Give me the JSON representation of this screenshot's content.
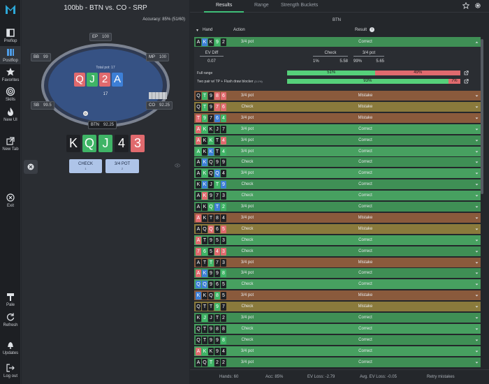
{
  "sidebar": {
    "items": [
      {
        "label": "Preflop",
        "icon": "preflop-icon"
      },
      {
        "label": "Postflop",
        "icon": "postflop-icon"
      },
      {
        "label": "Favorites",
        "icon": "star-icon"
      },
      {
        "label": "Skills",
        "icon": "target-icon"
      },
      {
        "label": "New UI",
        "icon": "flame-icon"
      },
      {
        "label": "New Tab",
        "icon": "new-tab-icon"
      },
      {
        "label": "Exit",
        "icon": "exit-icon"
      },
      {
        "label": "Pale",
        "icon": "paint-icon"
      },
      {
        "label": "Refresh",
        "icon": "refresh-icon"
      },
      {
        "label": "Updates",
        "icon": "bell-icon"
      },
      {
        "label": "Log out",
        "icon": "logout-icon"
      }
    ]
  },
  "trainer": {
    "title": "100bb - BTN vs. CO - SRP",
    "accuracy": "Accuracy:  85% (51/60)",
    "seats": {
      "ep": {
        "name": "EP",
        "stack": "100"
      },
      "mp": {
        "name": "MP",
        "stack": "100"
      },
      "bb": {
        "name": "BB",
        "stack": "99"
      },
      "sb": {
        "name": "SB",
        "stack": "99.5"
      },
      "co": {
        "name": "CO",
        "stack": "92.25"
      },
      "btn": {
        "name": "BTN",
        "stack": "92.25"
      }
    },
    "total_pot_label": "Total pot: 17",
    "pot": "17",
    "board": [
      {
        "rank": "Q",
        "suit": "hearts"
      },
      {
        "rank": "J",
        "suit": "clubs"
      },
      {
        "rank": "2",
        "suit": "hearts"
      },
      {
        "rank": "A",
        "suit": "diamonds"
      }
    ],
    "hero_cards": [
      {
        "rank": "K",
        "suit": "spades"
      },
      {
        "rank": "Q",
        "suit": "clubs"
      },
      {
        "rank": "J",
        "suit": "clubs"
      },
      {
        "rank": "4",
        "suit": "spades"
      },
      {
        "rank": "3",
        "suit": "hearts"
      }
    ],
    "dealer": "D",
    "actions": [
      {
        "label": "CHECK",
        "key": "1"
      },
      {
        "label": "3/4 POT",
        "key": "2"
      }
    ]
  },
  "results": {
    "tabs": [
      "Results",
      "Range",
      "Strength Buckets"
    ],
    "active_tab": "Results",
    "position_label": "BTN",
    "headers": {
      "hand": "Hand",
      "action": "Action",
      "result": "Result"
    },
    "expanded": {
      "hand": [
        {
          "rank": "A",
          "suit": "spades"
        },
        {
          "rank": "K",
          "suit": "diamonds"
        },
        {
          "rank": "K",
          "suit": "spades"
        },
        {
          "rank": "9",
          "suit": "clubs"
        },
        {
          "rank": "2",
          "suit": "spades"
        }
      ],
      "action": "3/4 pot",
      "result": "Correct",
      "ev_diff_label": "EV Diff",
      "ev_diff": "0.07",
      "check_label": "Check",
      "check_freq": "1%",
      "check_ev": "5.58",
      "bet_label": "3/4 pot",
      "bet_freq": "99%",
      "bet_ev": "5.65",
      "bars": [
        {
          "label": "Full range",
          "tag": "",
          "check_pct": 51,
          "bet_pct": 49,
          "check_text": "51%",
          "bet_text": "49%"
        },
        {
          "label": "Two pair w/ TP + Flush draw blocker",
          "tag": "(3.1%)",
          "check_pct": 93,
          "bet_pct": 7,
          "check_text": "93%",
          "bet_text": "7%"
        }
      ]
    },
    "rows": [
      {
        "cards": [
          [
            "Q",
            "spades"
          ],
          [
            "T",
            "clubs"
          ],
          [
            "9",
            "spades"
          ],
          [
            "8",
            "hearts"
          ],
          [
            "6",
            "hearts"
          ]
        ],
        "action": "3/4 pot",
        "result": "Mistake"
      },
      {
        "cards": [
          [
            "Q",
            "spades"
          ],
          [
            "T",
            "clubs"
          ],
          [
            "9",
            "spades"
          ],
          [
            "7",
            "hearts"
          ],
          [
            "6",
            "hearts"
          ]
        ],
        "action": "Check",
        "result": "Mistake"
      },
      {
        "cards": [
          [
            "T",
            "hearts"
          ],
          [
            "9",
            "clubs"
          ],
          [
            "7",
            "spades"
          ],
          [
            "6",
            "diamonds"
          ],
          [
            "4",
            "clubs"
          ]
        ],
        "action": "3/4 pot",
        "result": "Mistake"
      },
      {
        "cards": [
          [
            "A",
            "hearts"
          ],
          [
            "K",
            "clubs"
          ],
          [
            "K",
            "spades"
          ],
          [
            "J",
            "spades"
          ],
          [
            "7",
            "spades"
          ]
        ],
        "action": "3/4 pot",
        "result": "Correct"
      },
      {
        "cards": [
          [
            "A",
            "hearts"
          ],
          [
            "K",
            "spades"
          ],
          [
            "K",
            "clubs"
          ],
          [
            "T",
            "spades"
          ],
          [
            "4",
            "hearts"
          ]
        ],
        "action": "3/4 pot",
        "result": "Correct"
      },
      {
        "cards": [
          [
            "A",
            "clubs"
          ],
          [
            "K",
            "spades"
          ],
          [
            "K",
            "diamonds"
          ],
          [
            "T",
            "spades"
          ],
          [
            "4",
            "clubs"
          ]
        ],
        "action": "3/4 pot",
        "result": "Correct"
      },
      {
        "cards": [
          [
            "A",
            "spades"
          ],
          [
            "K",
            "diamonds"
          ],
          [
            "Q",
            "spades"
          ],
          [
            "9",
            "spades"
          ],
          [
            "9",
            "spades"
          ]
        ],
        "action": "Check",
        "result": "Correct"
      },
      {
        "cards": [
          [
            "A",
            "spades"
          ],
          [
            "K",
            "clubs"
          ],
          [
            "Q",
            "spades"
          ],
          [
            "Q",
            "diamonds"
          ],
          [
            "4",
            "spades"
          ]
        ],
        "action": "3/4 pot",
        "result": "Correct"
      },
      {
        "cards": [
          [
            "K",
            "spades"
          ],
          [
            "K",
            "diamonds"
          ],
          [
            "J",
            "spades"
          ],
          [
            "T",
            "clubs"
          ],
          [
            "9",
            "diamonds"
          ]
        ],
        "action": "Check",
        "result": "Correct"
      },
      {
        "cards": [
          [
            "A",
            "spades"
          ],
          [
            "K",
            "hearts"
          ],
          [
            "9",
            "spades"
          ],
          [
            "7",
            "spades"
          ],
          [
            "3",
            "spades"
          ]
        ],
        "action": "Check",
        "result": "Correct"
      },
      {
        "cards": [
          [
            "A",
            "spades"
          ],
          [
            "K",
            "spades"
          ],
          [
            "Q",
            "clubs"
          ],
          [
            "T",
            "diamonds"
          ],
          [
            "2",
            "clubs"
          ]
        ],
        "action": "3/4 pot",
        "result": "Correct"
      },
      {
        "cards": [
          [
            "A",
            "hearts"
          ],
          [
            "K",
            "spades"
          ],
          [
            "T",
            "spades"
          ],
          [
            "8",
            "spades"
          ],
          [
            "4",
            "spades"
          ]
        ],
        "action": "3/4 pot",
        "result": "Mistake"
      },
      {
        "cards": [
          [
            "A",
            "spades"
          ],
          [
            "Q",
            "spades"
          ],
          [
            "Q",
            "hearts"
          ],
          [
            "6",
            "spades"
          ],
          [
            "5",
            "hearts"
          ]
        ],
        "action": "Check",
        "result": "Mistake"
      },
      {
        "cards": [
          [
            "A",
            "hearts"
          ],
          [
            "T",
            "spades"
          ],
          [
            "9",
            "spades"
          ],
          [
            "5",
            "spades"
          ],
          [
            "3",
            "spades"
          ]
        ],
        "action": "Check",
        "result": "Correct"
      },
      {
        "cards": [
          [
            "7",
            "hearts"
          ],
          [
            "6",
            "clubs"
          ],
          [
            "5",
            "spades"
          ],
          [
            "4",
            "hearts"
          ],
          [
            "3",
            "hearts"
          ]
        ],
        "action": "Check",
        "result": "Correct"
      },
      {
        "cards": [
          [
            "A",
            "spades"
          ],
          [
            "T",
            "spades"
          ],
          [
            "T",
            "clubs"
          ],
          [
            "7",
            "spades"
          ],
          [
            "3",
            "spades"
          ]
        ],
        "action": "3/4 pot",
        "result": "Mistake"
      },
      {
        "cards": [
          [
            "A",
            "hearts"
          ],
          [
            "K",
            "diamonds"
          ],
          [
            "9",
            "spades"
          ],
          [
            "9",
            "spades"
          ],
          [
            "8",
            "clubs"
          ]
        ],
        "action": "3/4 pot",
        "result": "Correct"
      },
      {
        "cards": [
          [
            "Q",
            "diamonds"
          ],
          [
            "Q",
            "diamonds"
          ],
          [
            "9",
            "spades"
          ],
          [
            "6",
            "spades"
          ],
          [
            "5",
            "spades"
          ]
        ],
        "action": "Check",
        "result": "Correct"
      },
      {
        "cards": [
          [
            "K",
            "diamonds"
          ],
          [
            "K",
            "spades"
          ],
          [
            "Q",
            "spades"
          ],
          [
            "8",
            "clubs"
          ],
          [
            "5",
            "spades"
          ]
        ],
        "action": "3/4 pot",
        "result": "Mistake"
      },
      {
        "cards": [
          [
            "Q",
            "spades"
          ],
          [
            "T",
            "spades"
          ],
          [
            "T",
            "spades"
          ],
          [
            "9",
            "clubs"
          ],
          [
            "7",
            "spades"
          ]
        ],
        "action": "Check",
        "result": "Mistake"
      },
      {
        "cards": [
          [
            "K",
            "spades"
          ],
          [
            "J",
            "clubs"
          ],
          [
            "J",
            "spades"
          ],
          [
            "T",
            "spades"
          ],
          [
            "2",
            "spades"
          ]
        ],
        "action": "3/4 pot",
        "result": "Correct"
      },
      {
        "cards": [
          [
            "Q",
            "spades"
          ],
          [
            "T",
            "spades"
          ],
          [
            "9",
            "spades"
          ],
          [
            "8",
            "spades"
          ],
          [
            "8",
            "spades"
          ]
        ],
        "action": "Check",
        "result": "Correct"
      },
      {
        "cards": [
          [
            "Q",
            "spades"
          ],
          [
            "T",
            "spades"
          ],
          [
            "9",
            "spades"
          ],
          [
            "9",
            "spades"
          ],
          [
            "8",
            "clubs"
          ]
        ],
        "action": "Check",
        "result": "Correct"
      },
      {
        "cards": [
          [
            "A",
            "hearts"
          ],
          [
            "K",
            "clubs"
          ],
          [
            "K",
            "spades"
          ],
          [
            "9",
            "spades"
          ],
          [
            "4",
            "spades"
          ]
        ],
        "action": "3/4 pot",
        "result": "Correct"
      },
      {
        "cards": [
          [
            "A",
            "spades"
          ],
          [
            "Q",
            "spades"
          ],
          [
            "T",
            "clubs"
          ],
          [
            "2",
            "spades"
          ],
          [
            "2",
            "spades"
          ]
        ],
        "action": "3/4 pot",
        "result": "Correct"
      }
    ],
    "footer": {
      "hands": "Hands: 60",
      "acc": "Acc: 85%",
      "ev_loss": "EV Loss: -2.79",
      "avg_ev_loss": "Avg. EV Loss: -0.05",
      "retry": "Retry mistakes"
    }
  },
  "colors": {
    "correct_row": "#3f8f55",
    "correct_row_alt": "#47a060",
    "mistake_check": "#8a7a3c",
    "mistake_bet": "#8a5a3c",
    "hearts": "#e06a6e",
    "clubs": "#3fb466",
    "diamonds": "#3d7fd6",
    "spades": "#1f2125",
    "accent": "#3fbf78"
  }
}
